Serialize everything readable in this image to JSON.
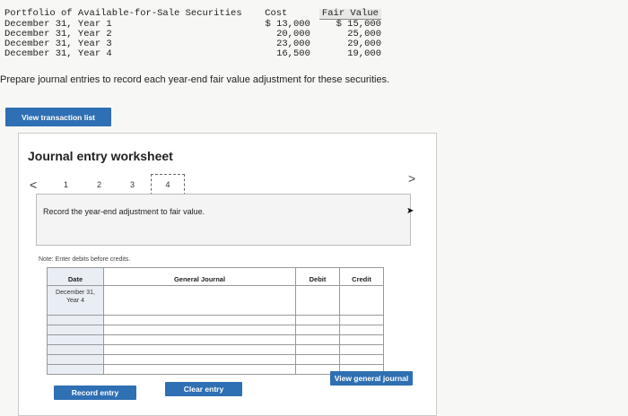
{
  "portfolio": {
    "title": "Portfolio of Available-for-Sale Securities",
    "cost_header": "Cost",
    "fair_value_header": "Fair Value",
    "rows": [
      {
        "label": "December 31, Year 1",
        "cost": "$ 13,000",
        "fair_value": "$ 15,000"
      },
      {
        "label": "December 31, Year 2",
        "cost": "20,000",
        "fair_value": "25,000"
      },
      {
        "label": "December 31, Year 3",
        "cost": "23,000",
        "fair_value": "29,000"
      },
      {
        "label": "December 31, Year 4",
        "cost": "16,500",
        "fair_value": "19,000"
      }
    ]
  },
  "instruction": "Prepare journal entries to record each year-end fair value adjustment for these securities.",
  "buttons": {
    "view_transaction_list": "View transaction list",
    "record_entry": "Record entry",
    "clear_entry": "Clear entry",
    "view_general_journal": "View general journal"
  },
  "worksheet": {
    "title": "Journal entry worksheet",
    "prev": "<",
    "next": ">",
    "pages": [
      "1",
      "2",
      "3",
      "4"
    ],
    "active_page": "4",
    "prompt": "Record the year-end adjustment to fair value.",
    "note": "Note: Enter debits before credits."
  },
  "journal": {
    "headers": {
      "date": "Date",
      "account": "General Journal",
      "debit": "Debit",
      "credit": "Credit"
    },
    "date_line1": "December 31,",
    "date_line2": "Year 4"
  }
}
